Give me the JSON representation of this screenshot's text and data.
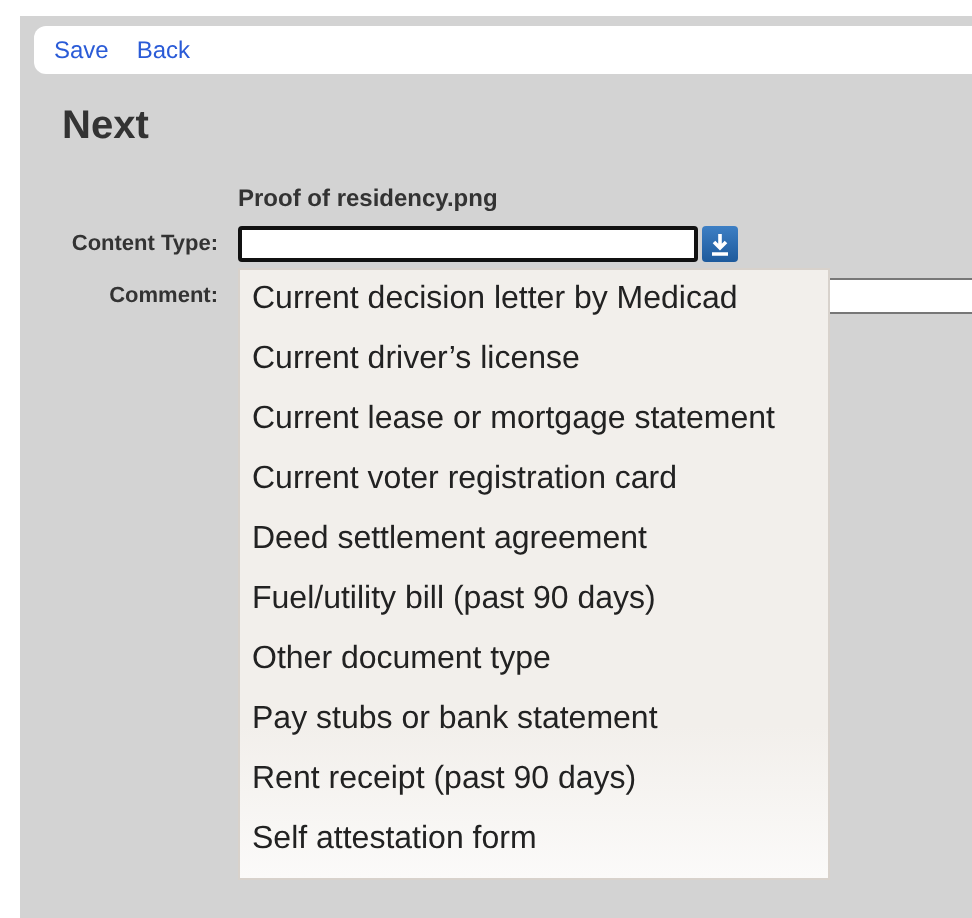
{
  "toolbar": {
    "links": [
      "Save",
      "Back"
    ]
  },
  "heading": "Next",
  "file_name": "Proof of residency.png",
  "content_type": {
    "label": "Content Type:",
    "expanded": true
  },
  "comment": {
    "label": "Comment:"
  },
  "options": [
    {
      "label": "Current decision letter by Medicad"
    },
    {
      "label": "Current driver’s license"
    },
    {
      "label": "Current lease or mortgage statement"
    },
    {
      "label": "Current voter registration card"
    },
    {
      "label": "Deed settlement agreement"
    },
    {
      "label": "Fuel/utility bill (past 90 days)"
    },
    {
      "label": "Other document type"
    },
    {
      "label": "Pay stubs or bank statement"
    },
    {
      "label": "Rent receipt (past 90 days)"
    },
    {
      "label": "Self attestation form"
    }
  ]
}
